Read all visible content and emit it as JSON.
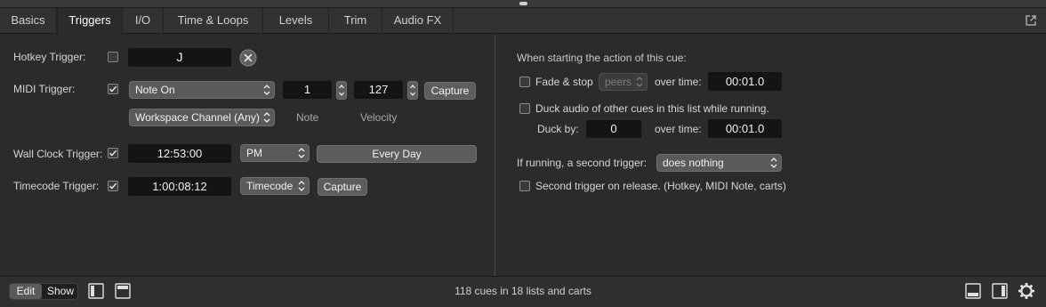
{
  "tabs": [
    "Basics",
    "Triggers",
    "I/O",
    "Time & Loops",
    "Levels",
    "Trim",
    "Audio FX"
  ],
  "left": {
    "hotkey_label": "Hotkey Trigger:",
    "hotkey_value": "J",
    "hotkey_checked": false,
    "midi_label": "MIDI Trigger:",
    "midi_checked": true,
    "midi_type": "Note On",
    "midi_note": "1",
    "midi_velocity": "127",
    "midi_capture": "Capture",
    "midi_channel": "Workspace Channel (Any)",
    "note_caption": "Note",
    "velocity_caption": "Velocity",
    "wallclock_label": "Wall Clock Trigger:",
    "wallclock_checked": true,
    "wallclock_time": "12:53:00",
    "wallclock_ampm": "PM",
    "wallclock_repeat": "Every Day",
    "timecode_label": "Timecode Trigger:",
    "timecode_checked": true,
    "timecode_value": "1:00:08:12",
    "timecode_type": "Timecode",
    "timecode_capture": "Capture"
  },
  "right": {
    "heading": "When starting the action of this cue:",
    "fade_label": "Fade & stop",
    "fade_target": "peers",
    "fade_overtime_label": "over time:",
    "fade_time": "00:01.0",
    "duck_label": "Duck audio of other cues in this list while running.",
    "duck_by_label": "Duck by:",
    "duck_by_value": "0",
    "duck_overtime_label": "over time:",
    "duck_time": "00:01.0",
    "second_trigger_label": "If running, a second trigger:",
    "second_trigger_value": "does nothing",
    "release_label": "Second trigger on release. (Hotkey, MIDI Note, carts)"
  },
  "bottom": {
    "edit_label": "Edit",
    "show_label": "Show",
    "status": "118 cues in 18 lists and carts"
  },
  "icons": {
    "clear": "clear-circle-icon",
    "popout": "popout-icon",
    "sidebar_left": "sidebar-left-icon",
    "panel_top": "panel-top-icon",
    "panel_bottom": "panel-bottom-icon",
    "sidebar_right": "sidebar-right-icon",
    "settings": "gear-icon"
  }
}
